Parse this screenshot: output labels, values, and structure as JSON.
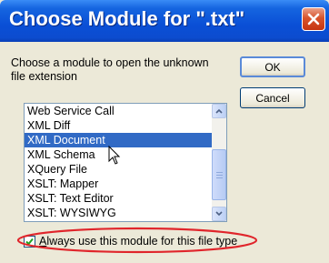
{
  "dialog": {
    "title": "Choose Module for \".txt\"",
    "prompt": "Choose a module to open the unknown file extension",
    "ok_label": "OK",
    "cancel_label": "Cancel"
  },
  "module_list": {
    "items": [
      "Web Service Call",
      "XML Diff",
      "XML Document",
      "XML Schema",
      "XQuery File",
      "XSLT: Mapper",
      "XSLT: Text Editor",
      "XSLT: WYSIWYG"
    ],
    "selected": "XML Document"
  },
  "checkbox": {
    "checked": true,
    "label_accesskey": "A",
    "label_rest": "lways use this module for this file type"
  },
  "colors": {
    "titlebar": "#0a4fd6",
    "selection": "#316ac5",
    "highlight_ellipse": "#e0252b",
    "close_button": "#d8542c"
  },
  "icons": {
    "close": "close-icon",
    "scroll_up": "chevron-up-icon",
    "scroll_down": "chevron-down-icon",
    "cursor": "arrow-cursor-icon",
    "check": "check-icon"
  }
}
